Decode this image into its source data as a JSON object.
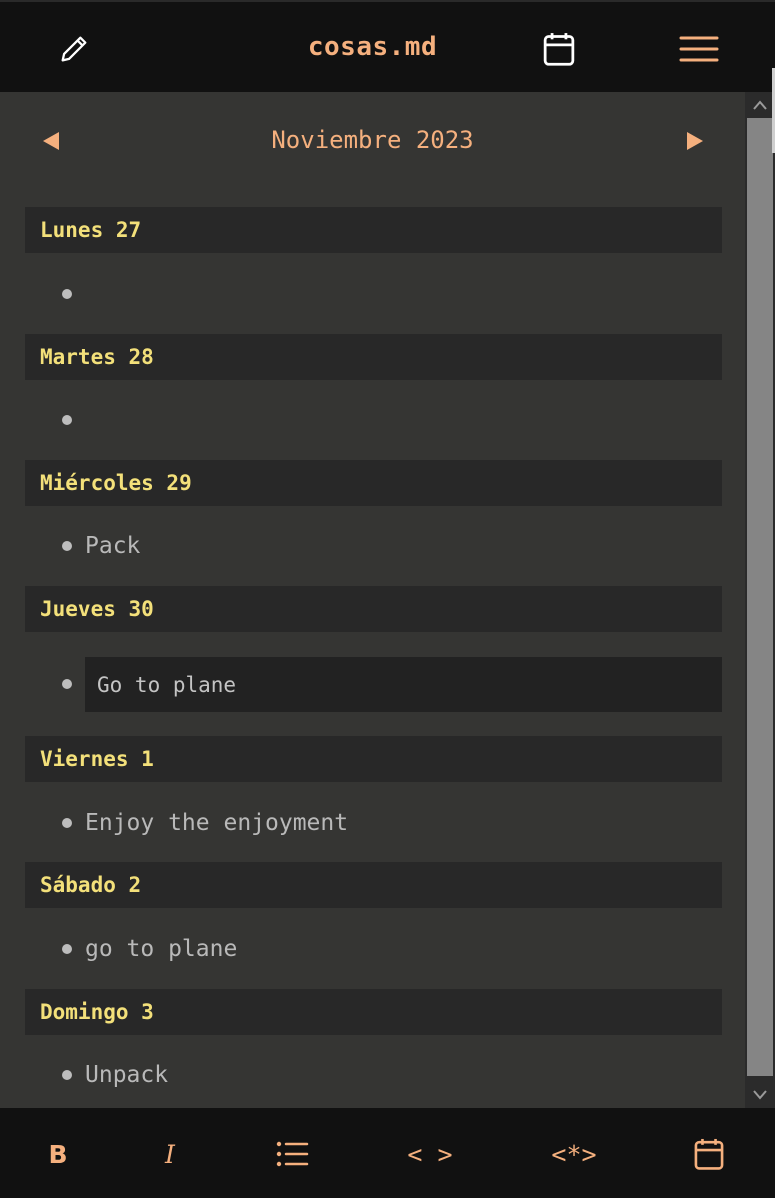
{
  "header": {
    "title": "cosas.md",
    "edit_icon": "pencil-icon",
    "calendar_icon": "calendar-icon",
    "menu_icon": "hamburger-menu-icon"
  },
  "month_nav": {
    "label": "Noviembre 2023",
    "prev_icon": "triangle-left-icon",
    "next_icon": "triangle-right-icon"
  },
  "days": [
    {
      "header": "Lunes 27",
      "tasks": [
        ""
      ]
    },
    {
      "header": "Martes 28",
      "tasks": [
        ""
      ]
    },
    {
      "header": "Miércoles 29",
      "tasks": [
        "Pack"
      ]
    },
    {
      "header": "Jueves 30",
      "editing": "Go to plane"
    },
    {
      "header": "Viernes 1",
      "tasks": [
        "Enjoy the enjoyment"
      ]
    },
    {
      "header": "Sábado 2",
      "tasks": [
        "go to plane"
      ]
    },
    {
      "header": "Domingo 3",
      "tasks": [
        "Unpack"
      ]
    }
  ],
  "toolbar": {
    "bold": "B",
    "italic": "I",
    "list_icon": "bulleted-list-icon",
    "code": "< >",
    "code_block": "<*>",
    "calendar_icon": "calendar-icon"
  },
  "colors": {
    "accent": "#f5b07e",
    "day_header_text": "#f3e07a",
    "background": "#353533",
    "bar": "#111111"
  }
}
